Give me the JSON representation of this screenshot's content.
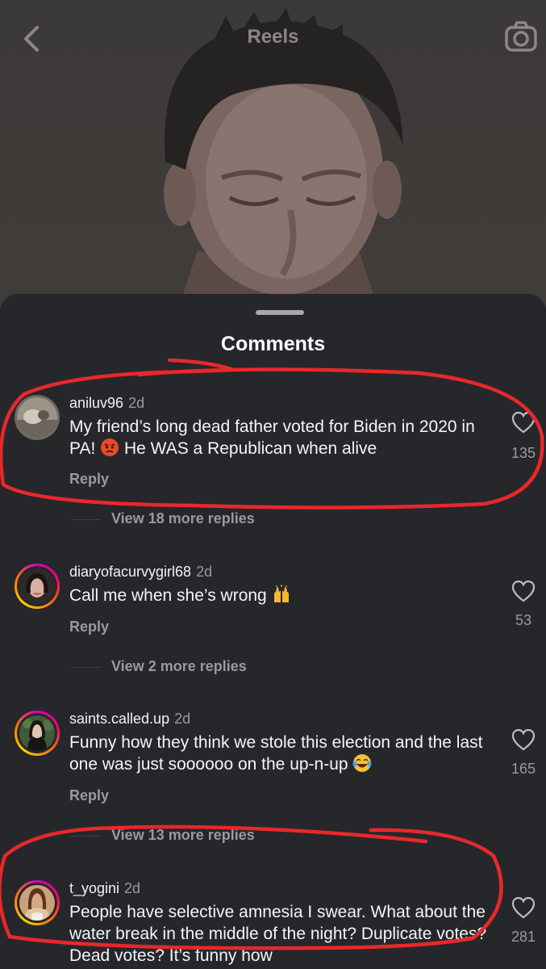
{
  "header": {
    "title": "Reels",
    "back_icon": "chevron-left-icon",
    "camera_icon": "camera-icon"
  },
  "sheet": {
    "title": "Comments"
  },
  "comments": [
    {
      "username": "aniluv96",
      "age": "2d",
      "text_a": "My friend’s long dead father voted for Biden in 2020 in PA!",
      "text_b": "He WAS a Republican when alive",
      "likes": "135",
      "reply": "Reply",
      "view_more": "View 18 more replies"
    },
    {
      "username": "diaryofacurvygirl68",
      "age": "2d",
      "text": "Call me when she’s wrong",
      "likes": "53",
      "reply": "Reply",
      "view_more": "View 2 more replies"
    },
    {
      "username": "saints.called.up",
      "age": "2d",
      "text": "Funny how they think we stole this election and the last one was just soooooo on the up-n-up",
      "likes": "165",
      "reply": "Reply",
      "view_more": "View 13 more replies"
    },
    {
      "username": "t_yogini",
      "age": "2d",
      "text": "People have selective amnesia I swear. What about the water break in the middle of the night?",
      "text_partial": "Duplicate votes? Dead votes? It’s funny how",
      "likes": "281"
    }
  ],
  "colors": {
    "sheet_bg": "#26272b",
    "muted_text": "#9a9a9e",
    "annotation_red": "#e8282b"
  }
}
